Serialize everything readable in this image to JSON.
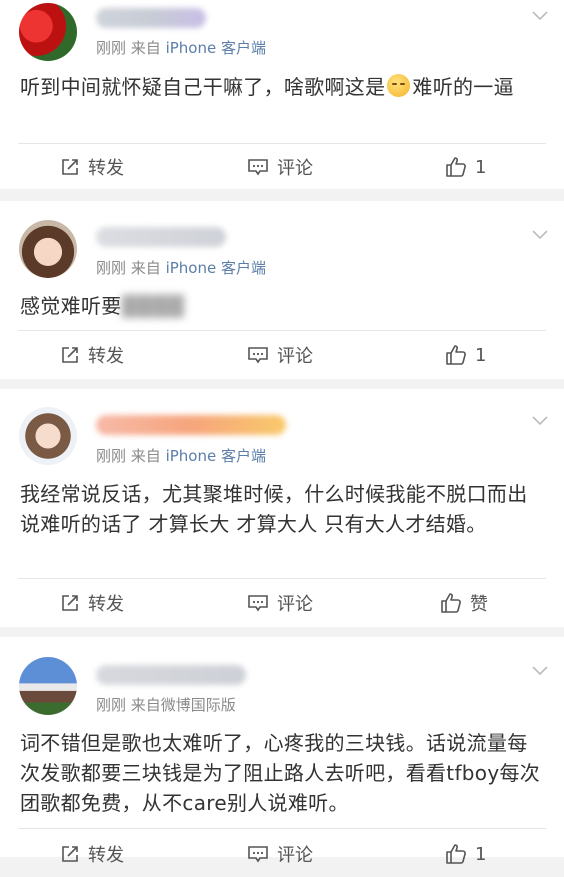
{
  "comments": [
    {
      "source_prefix": "刚刚  来自",
      "source": "iPhone 客户端",
      "content_before_emoji": "听到中间就怀疑自己干嘛了，啥歌啊这是",
      "emoji": "sleepy-face-emoji",
      "content_after_emoji": "难听的一逼",
      "repost": "转发",
      "comment": "评论",
      "like": "1"
    },
    {
      "source_prefix": "刚刚  来自",
      "source": "iPhone 客户端",
      "content": "感觉难听要",
      "repost": "转发",
      "comment": "评论",
      "like": "1"
    },
    {
      "source_prefix": "刚刚  来自",
      "source": "iPhone 客户端",
      "content": "我经常说反话，尤其聚堆时候，什么时候我能不脱口而出说难听的话了 才算长大 才算大人 只有大人才结婚。",
      "repost": "转发",
      "comment": "评论",
      "like": "赞"
    },
    {
      "source_prefix": "刚刚  来自微博国际版",
      "source": "",
      "content": "词不错但是歌也太难听了，心疼我的三块钱。话说流量每次发歌都要三块钱是为了阻止路人去听吧，看看tfboy每次团歌都免费，从不care别人说难听。",
      "repost": "转发",
      "comment": "评论",
      "like": "1"
    }
  ],
  "colors": {
    "background": "#f2f2f2",
    "source_link": "#5b7ea8",
    "meta_text": "#8a8a8a",
    "body_text": "#333333"
  }
}
